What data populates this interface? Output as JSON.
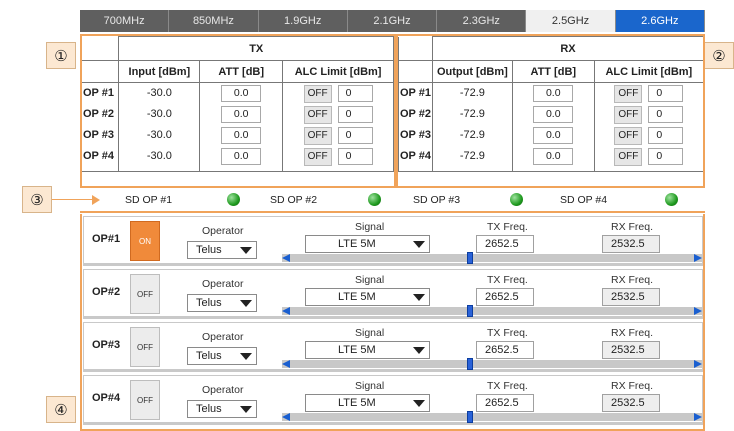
{
  "bands": [
    "700MHz",
    "850MHz",
    "1.9GHz",
    "2.1GHz",
    "2.3GHz",
    "2.5GHz",
    "2.6GHz"
  ],
  "callouts": [
    "①",
    "②",
    "③",
    "④"
  ],
  "tx": {
    "title": "TX",
    "headers": [
      "Input [dBm]",
      "ATT [dB]",
      "ALC Limit [dBm]"
    ],
    "rows": [
      {
        "op": "OP #1",
        "input": "-30.0",
        "att": "0.0",
        "alc_btn": "OFF",
        "alc": "0"
      },
      {
        "op": "OP #2",
        "input": "-30.0",
        "att": "0.0",
        "alc_btn": "OFF",
        "alc": "0"
      },
      {
        "op": "OP #3",
        "input": "-30.0",
        "att": "0.0",
        "alc_btn": "OFF",
        "alc": "0"
      },
      {
        "op": "OP #4",
        "input": "-30.0",
        "att": "0.0",
        "alc_btn": "OFF",
        "alc": "0"
      }
    ]
  },
  "rx": {
    "title": "RX",
    "headers": [
      "Output [dBm]",
      "ATT [dB]",
      "ALC Limit [dBm]"
    ],
    "rows": [
      {
        "op": "OP #1",
        "output": "-72.9",
        "att": "0.0",
        "alc_btn": "OFF",
        "alc": "0"
      },
      {
        "op": "OP #2",
        "output": "-72.9",
        "att": "0.0",
        "alc_btn": "OFF",
        "alc": "0"
      },
      {
        "op": "OP #3",
        "output": "-72.9",
        "att": "0.0",
        "alc_btn": "OFF",
        "alc": "0"
      },
      {
        "op": "OP #4",
        "output": "-72.9",
        "att": "0.0",
        "alc_btn": "OFF",
        "alc": "0"
      }
    ]
  },
  "sd": [
    "SD OP #1",
    "SD OP #2",
    "SD OP #3",
    "SD OP #4"
  ],
  "ops": [
    {
      "name": "OP#1",
      "state": "ON",
      "operator_label": "Operator",
      "operator": "Telus",
      "signal_label": "Signal",
      "signal": "LTE 5M",
      "tx_label": "TX Freq.",
      "tx": "2652.5",
      "rx_label": "RX Freq.",
      "rx": "2532.5"
    },
    {
      "name": "OP#2",
      "state": "OFF",
      "operator_label": "Operator",
      "operator": "Telus",
      "signal_label": "Signal",
      "signal": "LTE 5M",
      "tx_label": "TX Freq.",
      "tx": "2652.5",
      "rx_label": "RX Freq.",
      "rx": "2532.5"
    },
    {
      "name": "OP#3",
      "state": "OFF",
      "operator_label": "Operator",
      "operator": "Telus",
      "signal_label": "Signal",
      "signal": "LTE 5M",
      "tx_label": "TX Freq.",
      "tx": "2652.5",
      "rx_label": "RX Freq.",
      "rx": "2532.5"
    },
    {
      "name": "OP#4",
      "state": "OFF",
      "operator_label": "Operator",
      "operator": "Telus",
      "signal_label": "Signal",
      "signal": "LTE 5M",
      "tx_label": "TX Freq.",
      "tx": "2652.5",
      "rx_label": "RX Freq.",
      "rx": "2532.5"
    }
  ],
  "colors": {
    "accent": "#1a66cc",
    "frame": "#f0a35a",
    "on": "#f08a3a",
    "led": "#1f9a1f"
  }
}
